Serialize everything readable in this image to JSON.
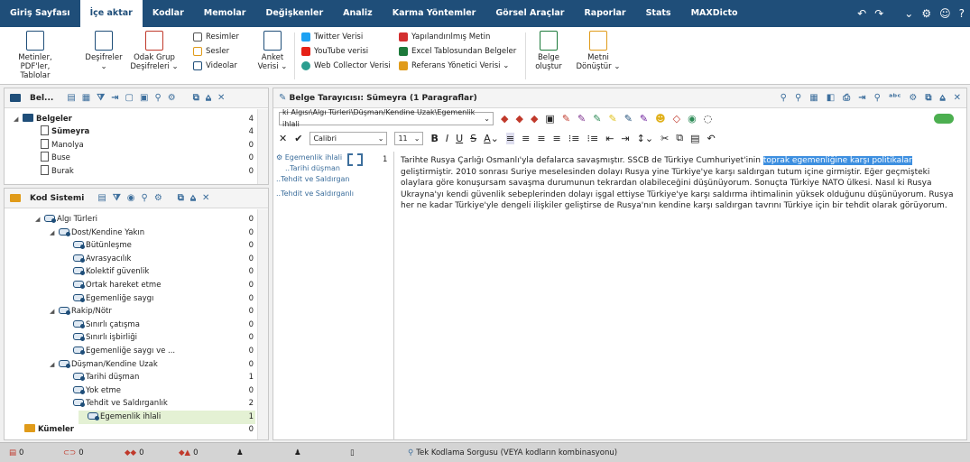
{
  "menu": {
    "items": [
      "Giriş Sayfası",
      "İçe aktar",
      "Kodlar",
      "Memolar",
      "Değişkenler",
      "Analiz",
      "Karma Yöntemler",
      "Görsel Araçlar",
      "Raporlar",
      "Stats",
      "MAXDicto"
    ],
    "active_index": 1
  },
  "window_controls": [
    "↶",
    "↷",
    "⌄",
    "⚙",
    "☺",
    "?"
  ],
  "ribbon": {
    "big": [
      {
        "line1": "Metinler, PDF'ler,",
        "line2": "Tablolar"
      },
      {
        "line1": "Deşifreler",
        "line2": "⌄"
      },
      {
        "line1": "Odak Grup",
        "line2": "Deşifreleri ⌄"
      },
      {
        "line1": "Anket",
        "line2": "Verisi ⌄"
      },
      {
        "line1": "Belge",
        "line2": "oluştur"
      },
      {
        "line1": "Metni",
        "line2": "Dönüştür ⌄"
      }
    ],
    "media": [
      "Resimler",
      "Sesler",
      "Videolar"
    ],
    "web": [
      "Twitter Verisi",
      "YouTube verisi",
      "Web Collector Verisi"
    ],
    "other": [
      "Yapılandırılmış Metin",
      "Excel Tablosundan Belgeler",
      "Referans Yönetici Verisi ⌄"
    ],
    "colors": {
      "twitter": "#1da1f2",
      "youtube": "#e62117",
      "web": "#2a9d8f",
      "struct": "#d32f2f",
      "excel": "#1d7a3b",
      "ref": "#e09b1a"
    }
  },
  "docs": {
    "title": "Bel...",
    "root": {
      "label": "Belgeler",
      "count": "4"
    },
    "items": [
      {
        "label": "Sümeyra",
        "count": "4",
        "bold": true
      },
      {
        "label": "Manolya",
        "count": "0",
        "bold": false
      },
      {
        "label": "Buse",
        "count": "0",
        "bold": false
      },
      {
        "label": "Burak",
        "count": "0",
        "bold": false
      }
    ]
  },
  "codes": {
    "title": "Kod Sistemi",
    "items": [
      {
        "label": "Algı Türleri",
        "count": "0",
        "level": 0,
        "tri": "◢"
      },
      {
        "label": "Dost/Kendine Yakın",
        "count": "0",
        "level": 1,
        "tri": "◢"
      },
      {
        "label": "Bütünleşme",
        "count": "0",
        "level": 2,
        "tri": ""
      },
      {
        "label": "Avrasyacılık",
        "count": "0",
        "level": 2,
        "tri": ""
      },
      {
        "label": "Kolektif güvenlik",
        "count": "0",
        "level": 2,
        "tri": ""
      },
      {
        "label": "Ortak hareket etme",
        "count": "0",
        "level": 2,
        "tri": ""
      },
      {
        "label": "Egemenliğe saygı",
        "count": "0",
        "level": 2,
        "tri": ""
      },
      {
        "label": "Rakip/Nötr",
        "count": "0",
        "level": 1,
        "tri": "◢"
      },
      {
        "label": "Sınırlı çatışma",
        "count": "0",
        "level": 2,
        "tri": ""
      },
      {
        "label": "Sınırlı işbirliği",
        "count": "0",
        "level": 2,
        "tri": ""
      },
      {
        "label": "Egemenliğe saygı ve ...",
        "count": "0",
        "level": 2,
        "tri": ""
      },
      {
        "label": "Düşman/Kendine Uzak",
        "count": "0",
        "level": 1,
        "tri": "◢"
      },
      {
        "label": "Tarihi düşman",
        "count": "1",
        "level": 2,
        "tri": ""
      },
      {
        "label": "Yok etme",
        "count": "0",
        "level": 2,
        "tri": ""
      },
      {
        "label": "Tehdit ve Saldırganlık",
        "count": "2",
        "level": 2,
        "tri": ""
      },
      {
        "label": "Egemenlik ihlali",
        "count": "1",
        "level": 2,
        "tri": "",
        "selected": true
      }
    ],
    "sets": {
      "label": "Kümeler",
      "count": "0"
    }
  },
  "browser": {
    "title": "Belge Tarayıcısı: Sümeyra",
    "subtitle": "(1 Paragraflar)",
    "code_path": "ki Algısı\\Algı Türleri\\Düşman/Kendine Uzak\\Egemenlik ihlali",
    "font": "Calibri",
    "size": "11",
    "para_num": "1",
    "code_stripes": [
      "Egemenlik ihlali",
      "..Tarihi düşman",
      "..Tehdit ve Saldırgan",
      "..Tehdit ve Saldırganlı"
    ],
    "text_before": "Tarihte Rusya Çarlığı Osmanlı'yla defalarca savaşmıştır. SSCB de Türkiye Cumhuriyet'inin ",
    "text_highlight": "toprak egemenliğine karşı politikalar",
    "text_after": " geliştirmiştir. 2010 sonrası Suriye meselesinden dolayı Rusya yine Türkiye'ye karşı saldırgan tutum içine girmiştir. Eğer geçmişteki olaylara göre konuşursam savaşma durumunun tekrardan olabileceğini düşünüyorum. Sonuçta Türkiye NATO ülkesi. Nasıl ki Rusya Ukrayna'yı kendi güvenlik sebeplerinden dolayı işgal ettiyse Türkiye'ye karşı saldırma ihtimalinin yüksek olduğunu düşünüyorum. Rusya her ne kadar Türkiye'yle dengeli ilişkiler geliştirse de Rusya'nın kendine karşı saldırgan tavrını Türkiye için bir tehdit olarak görüyorum."
  },
  "status": {
    "items": [
      "0",
      "0",
      "0",
      "0"
    ],
    "query": "Tek Kodlama Sorgusu (VEYA kodların kombinasyonu)"
  }
}
